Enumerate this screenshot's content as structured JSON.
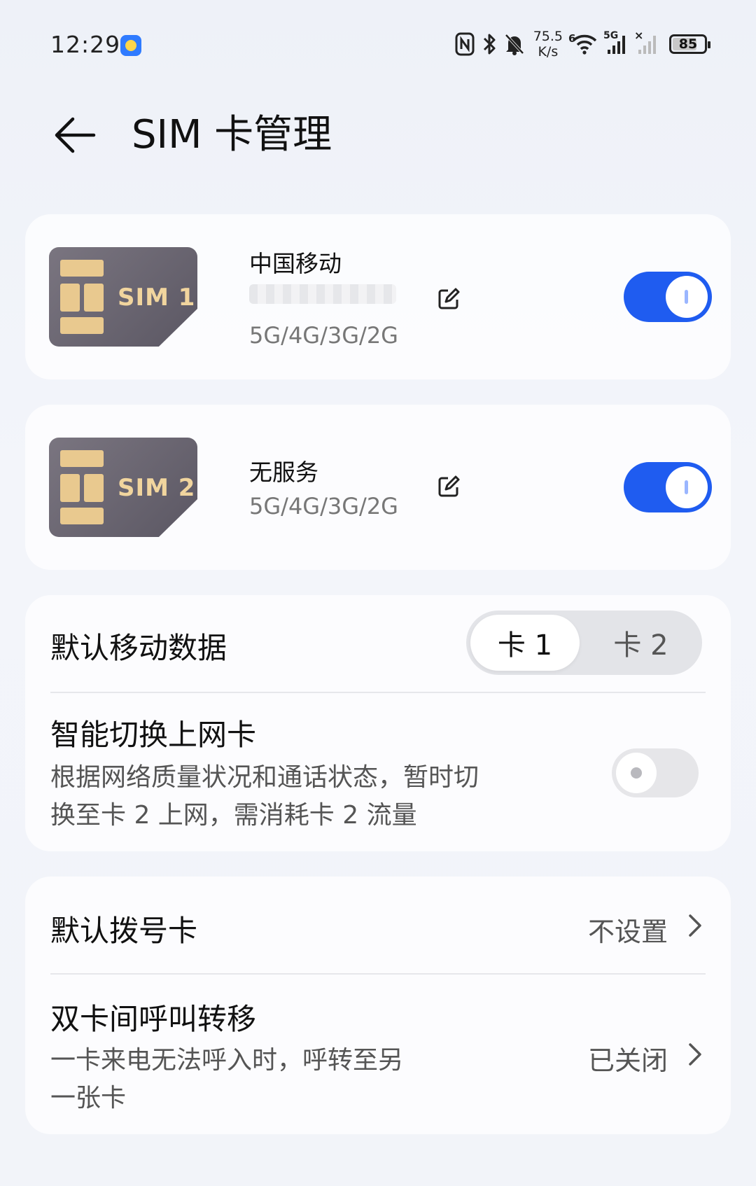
{
  "status_bar": {
    "time": "12:29",
    "net_speed_value": "75.5",
    "net_speed_unit": "K/s",
    "wifi_badge": "6",
    "signal_badge": "5G",
    "battery": "85",
    "icons": [
      "nfc-icon",
      "bluetooth-icon",
      "bell-off-icon",
      "wifi-icon",
      "signal-sim1-icon",
      "signal-sim2-icon",
      "battery-icon"
    ]
  },
  "header": {
    "title": "SIM 卡管理"
  },
  "sims": [
    {
      "card_label": "SIM 1",
      "carrier": "中国移动",
      "bands": "5G/4G/3G/2G",
      "enabled": true
    },
    {
      "card_label": "SIM 2",
      "carrier": "无服务",
      "bands": "5G/4G/3G/2G",
      "enabled": true
    }
  ],
  "data_settings": {
    "default_data_title": "默认移动数据",
    "options": [
      "卡 1",
      "卡 2"
    ],
    "selected": "卡 1",
    "smart_switch_title": "智能切换上网卡",
    "smart_switch_desc_line1": "根据网络质量状况和通话状态，暂时切",
    "smart_switch_desc_line2": "换至卡 2 上网，需消耗卡 2 流量",
    "smart_switch_enabled": false
  },
  "call_settings": {
    "default_dial_title": "默认拨号卡",
    "default_dial_value": "不设置",
    "forward_title": "双卡间呼叫转移",
    "forward_desc_line1": "一卡来电无法呼入时，呼转至另",
    "forward_desc_line2": "一张卡",
    "forward_value": "已关闭"
  },
  "colors": {
    "accent": "#1f5cf0",
    "sim_card": "#67626d",
    "chip": "#e9c98f"
  }
}
